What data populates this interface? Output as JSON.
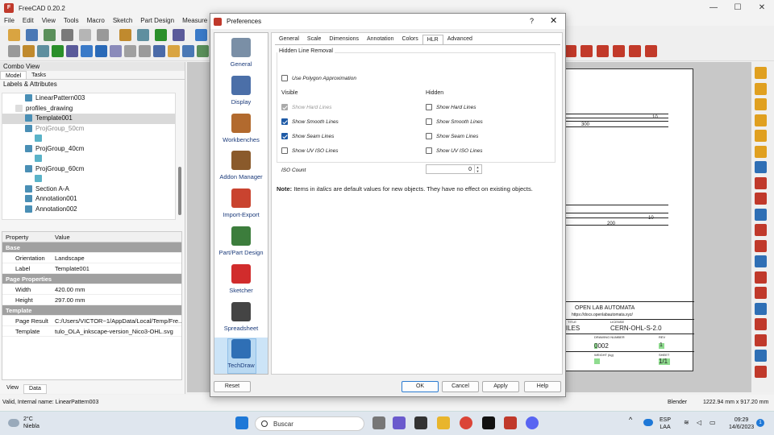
{
  "app": {
    "title": "FreeCAD 0.20.2",
    "menu": [
      "File",
      "Edit",
      "View",
      "Tools",
      "Macro",
      "Sketch",
      "Part Design",
      "Measure",
      "W"
    ]
  },
  "combo_view": {
    "title": "Combo View",
    "tabs": [
      "Model",
      "Tasks"
    ],
    "tree_header": "Labels & Attributes",
    "tree": [
      {
        "label": "LinearPattern003",
        "indent": 2
      },
      {
        "label": "profiles_drawing",
        "indent": 1
      },
      {
        "label": "Template001",
        "indent": 2,
        "selected": true
      },
      {
        "label": "ProjGroup_50cm",
        "indent": 2,
        "dim": true
      },
      {
        "label": "",
        "indent": 3
      },
      {
        "label": "ProjGroup_40cm",
        "indent": 2
      },
      {
        "label": "",
        "indent": 3
      },
      {
        "label": "ProjGroup_60cm",
        "indent": 2
      },
      {
        "label": "",
        "indent": 3
      },
      {
        "label": "Section A-A",
        "indent": 2
      },
      {
        "label": "Annotation001",
        "indent": 2
      },
      {
        "label": "Annotation002",
        "indent": 2
      }
    ],
    "property_header": {
      "key": "Property",
      "value": "Value"
    },
    "properties": [
      {
        "group": "Base"
      },
      {
        "key": "Orientation",
        "value": "Landscape"
      },
      {
        "key": "Label",
        "value": "Template001"
      },
      {
        "group": "Page Properties"
      },
      {
        "key": "Width",
        "value": "420.00 mm"
      },
      {
        "key": "Height",
        "value": "297.00 mm"
      },
      {
        "group": "Template"
      },
      {
        "key": "Page Result",
        "value": "C:/Users/VICTOR~1/AppData/Local/Temp/Fre..."
      },
      {
        "key": "Template",
        "value": "tulo_OLA_inkscape-version_Nico3-OHL.svg"
      }
    ],
    "bottom_tabs": [
      "View",
      "Data"
    ]
  },
  "status_bar": {
    "message": "Valid, Internal name: LinearPattern003",
    "nav_style": "Blender",
    "dimensions": "1222.94 mm x 917.20 mm"
  },
  "drawing": {
    "dims": [
      "10",
      "300",
      "10",
      "200"
    ],
    "title_block": {
      "org": "OPEN LAB AUTOMATA",
      "url": "https://docs.openlabautomata.xyz/",
      "title_label": "TITLE",
      "title_value": "FILES",
      "license_label": "LICENSE",
      "license_value": "CERN-OHL-S-2.0",
      "drawing_number_label": "DRAWING NUMBER",
      "drawing_number_value": "0002",
      "rev_label": "REV",
      "rev_value": "1",
      "weight_label": "WEIGHT (kg)",
      "sheet_label": "SHEET",
      "sheet_value": "1/1"
    }
  },
  "dialog": {
    "title": "Preferences",
    "help": "?",
    "close": "✕",
    "pages": [
      {
        "label": "General",
        "icon": "general-icon",
        "color": "#7a8fa6"
      },
      {
        "label": "Display",
        "icon": "display-icon",
        "color": "#4b6fa8"
      },
      {
        "label": "Workbenches",
        "icon": "workbenches-icon",
        "color": "#b26a2e"
      },
      {
        "label": "Addon Manager",
        "icon": "addon-manager-icon",
        "color": "#8a5a2b"
      },
      {
        "label": "Import-Export",
        "icon": "import-export-icon",
        "color": "#c9432f"
      },
      {
        "label": "Part/Part Design",
        "icon": "part-design-icon",
        "color": "#3c7d3c"
      },
      {
        "label": "Sketcher",
        "icon": "sketcher-icon",
        "color": "#d12c2c"
      },
      {
        "label": "Spreadsheet",
        "icon": "spreadsheet-icon",
        "color": "#444444"
      },
      {
        "label": "TechDraw",
        "icon": "techdraw-icon",
        "color": "#2f6fb5",
        "active": true
      }
    ],
    "tabs": [
      "General",
      "Scale",
      "Dimensions",
      "Annotation",
      "Colors",
      "HLR",
      "Advanced"
    ],
    "active_tab": "HLR",
    "group_title": "Hidden Line Removal",
    "use_polygon": {
      "label": "Use Polygon Approximation",
      "checked": false
    },
    "visible_header": "Visible",
    "hidden_header": "Hidden",
    "visible": [
      {
        "label": "Show Hard Lines",
        "checked": true,
        "disabled": true
      },
      {
        "label": "Show Smooth Lines",
        "checked": true
      },
      {
        "label": "Show Seam Lines",
        "checked": true
      },
      {
        "label": "Show UV ISO Lines",
        "checked": false
      }
    ],
    "hidden": [
      {
        "label": "Show Hard Lines",
        "checked": false
      },
      {
        "label": "Show Smooth Lines",
        "checked": false
      },
      {
        "label": "Show Seam Lines",
        "checked": false
      },
      {
        "label": "Show UV ISO Lines",
        "checked": false
      }
    ],
    "iso_count_label": "ISO Count",
    "iso_count_value": "0",
    "note_bold": "Note:",
    "note_pre": " Items in ",
    "note_italic": "italics",
    "note_post": " are default values for new objects. They have no effect on existing objects.",
    "buttons": {
      "reset": "Reset",
      "ok": "OK",
      "cancel": "Cancel",
      "apply": "Apply",
      "help": "Help"
    }
  },
  "taskbar": {
    "temperature": "2°C",
    "weather": "Niebla",
    "search_placeholder": "Buscar",
    "lang": "ESP",
    "lang_sub": "LAA",
    "time": "09:29",
    "date": "14/6/2023",
    "notif_count": "1"
  }
}
